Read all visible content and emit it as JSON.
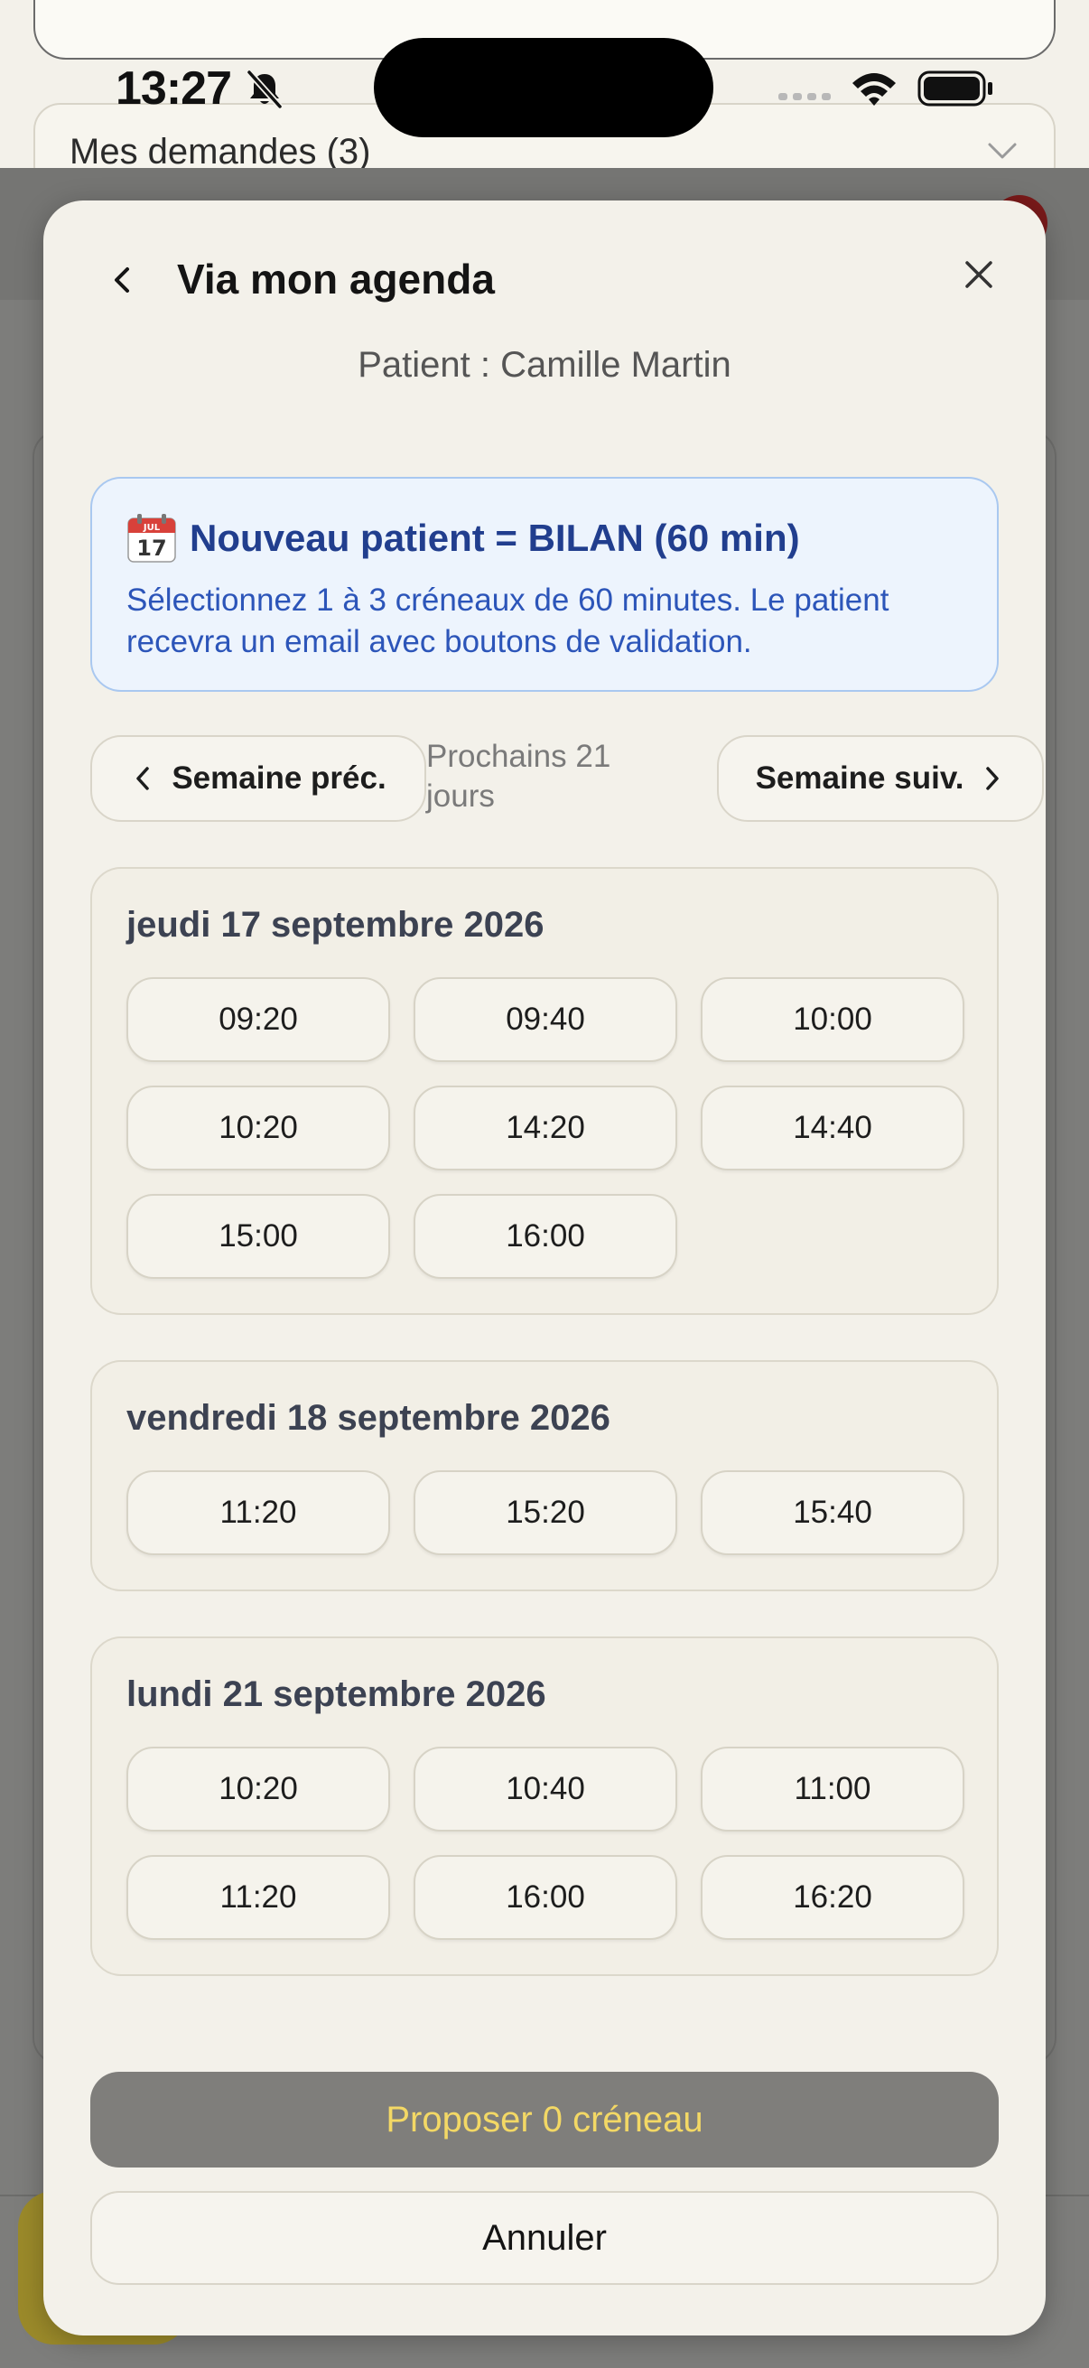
{
  "status_bar": {
    "time": "13:27"
  },
  "background": {
    "requests_label": "Mes demandes (3)"
  },
  "modal": {
    "title": "Via mon agenda",
    "patient_line": "Patient : Camille Martin",
    "info": {
      "title": "Nouveau patient = BILAN (60 min)",
      "calendar_month": "JUL",
      "calendar_day": "17",
      "text": "Sélectionnez 1 à 3 créneaux de 60 minutes. Le patient recevra un email avec boutons de validation."
    },
    "week_nav": {
      "prev_label": "Semaine préc.",
      "range_label": "Prochains 21 jours",
      "next_label": "Semaine suiv."
    },
    "days": [
      {
        "label": "jeudi 17 septembre 2026",
        "slots": [
          "09:20",
          "09:40",
          "10:00",
          "10:20",
          "14:20",
          "14:40",
          "15:00",
          "16:00"
        ]
      },
      {
        "label": "vendredi 18 septembre 2026",
        "slots": [
          "11:20",
          "15:20",
          "15:40"
        ]
      },
      {
        "label": "lundi 21 septembre 2026",
        "slots": [
          "10:20",
          "10:40",
          "11:00",
          "11:20",
          "16:00",
          "16:20"
        ]
      }
    ],
    "propose_label": "Proposer 0 créneau",
    "cancel_label": "Annuler"
  },
  "colors": {
    "info_title": "#213e8e",
    "info_text": "#2c55b9",
    "propose_bg": "#7f7e7b",
    "propose_text": "#f3d865"
  },
  "icons": {
    "back": "chevron-left-icon",
    "close": "close-icon",
    "calendar": "calendar-icon",
    "prev": "chevron-left-icon",
    "next": "chevron-right-icon",
    "silent": "bell-slash-icon",
    "wifi": "wifi-icon",
    "battery": "battery-icon"
  }
}
